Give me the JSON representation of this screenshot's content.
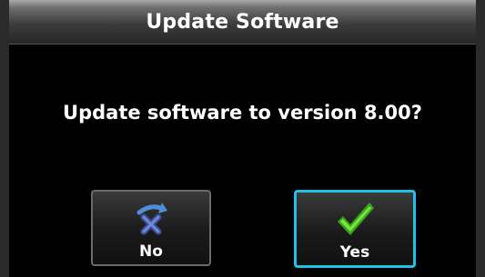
{
  "dialog": {
    "title": "Update Software",
    "message": "Update software to version 8.00?"
  },
  "buttons": {
    "no": {
      "label": "No",
      "icon": "undo-x-icon",
      "icon_color": "#4f8fd8"
    },
    "yes": {
      "label": "Yes",
      "icon": "checkmark-icon",
      "icon_color": "#5cd12c",
      "highlight_color": "#1fc2e6"
    }
  }
}
